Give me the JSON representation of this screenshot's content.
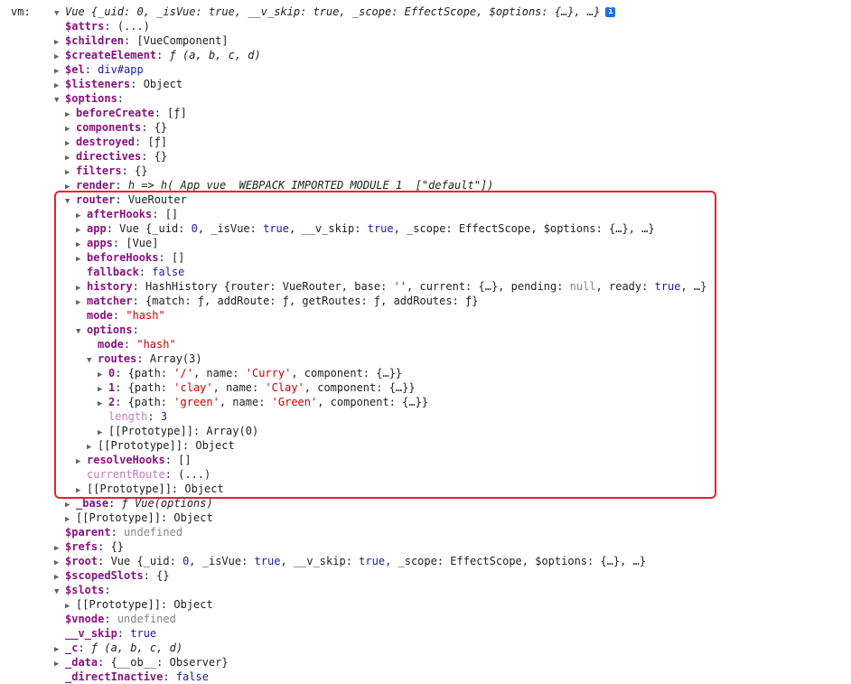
{
  "header": {
    "var_label": "vm:",
    "summary": "Vue {_uid: 0, _isVue: true, __v_skip: true, _scope: EffectScope, $options: {…}, …}",
    "info_icon": "info-icon"
  },
  "highlight_color": "#e8232b",
  "rows": [
    {
      "d": 0,
      "a": "",
      "k": "$attrs",
      "s": "own",
      "v": [
        [
          "(...)",
          "plain"
        ]
      ]
    },
    {
      "d": 0,
      "a": "c",
      "k": "$children",
      "s": "own",
      "v": [
        [
          "[VueComponent]",
          "plain"
        ]
      ]
    },
    {
      "d": 0,
      "a": "c",
      "k": "$createElement",
      "s": "own",
      "v": [
        [
          "ƒ (a, b, c, d)",
          "fn"
        ]
      ]
    },
    {
      "d": 0,
      "a": "c",
      "k": "$el",
      "s": "own",
      "v": [
        [
          "div#app",
          "kw"
        ]
      ]
    },
    {
      "d": 0,
      "a": "c",
      "k": "$listeners",
      "s": "own",
      "v": [
        [
          "Object",
          "plain"
        ]
      ]
    },
    {
      "d": 0,
      "a": "e",
      "k": "$options",
      "s": "own",
      "v": []
    },
    {
      "d": 1,
      "a": "c",
      "k": "beforeCreate",
      "s": "own",
      "v": [
        [
          "[ƒ]",
          "plain"
        ]
      ]
    },
    {
      "d": 1,
      "a": "c",
      "k": "components",
      "s": "own",
      "v": [
        [
          "{}",
          "plain"
        ]
      ]
    },
    {
      "d": 1,
      "a": "c",
      "k": "destroyed",
      "s": "own",
      "v": [
        [
          "[ƒ]",
          "plain"
        ]
      ]
    },
    {
      "d": 1,
      "a": "c",
      "k": "directives",
      "s": "own",
      "v": [
        [
          "{}",
          "plain"
        ]
      ]
    },
    {
      "d": 1,
      "a": "c",
      "k": "filters",
      "s": "own",
      "v": [
        [
          "{}",
          "plain"
        ]
      ]
    },
    {
      "d": 1,
      "a": "c",
      "k": "render",
      "s": "own",
      "v": [
        [
          "h => h(_App_vue__WEBPACK_IMPORTED_MODULE_1__[\"default\"])",
          "fn"
        ]
      ]
    },
    {
      "d": 1,
      "a": "e",
      "k": "router",
      "s": "own",
      "v": [
        [
          "VueRouter",
          "plain"
        ]
      ]
    },
    {
      "d": 2,
      "a": "c",
      "k": "afterHooks",
      "s": "own",
      "v": [
        [
          "[]",
          "plain"
        ]
      ]
    },
    {
      "d": 2,
      "a": "c",
      "k": "app",
      "s": "own",
      "v": [
        [
          "Vue {_uid: ",
          "plain"
        ],
        [
          "0",
          "num"
        ],
        [
          ", _isVue: ",
          "plain"
        ],
        [
          "true",
          "kw"
        ],
        [
          ", __v_skip: ",
          "plain"
        ],
        [
          "true",
          "kw"
        ],
        [
          ", _scope: EffectScope, $options: {…}, …}",
          "plain"
        ]
      ]
    },
    {
      "d": 2,
      "a": "c",
      "k": "apps",
      "s": "own",
      "v": [
        [
          "[Vue]",
          "plain"
        ]
      ]
    },
    {
      "d": 2,
      "a": "c",
      "k": "beforeHooks",
      "s": "own",
      "v": [
        [
          "[]",
          "plain"
        ]
      ]
    },
    {
      "d": 2,
      "a": "",
      "k": "fallback",
      "s": "own",
      "v": [
        [
          "false",
          "kw"
        ]
      ]
    },
    {
      "d": 2,
      "a": "c",
      "k": "history",
      "s": "own",
      "v": [
        [
          "HashHistory {router: VueRouter, base: ",
          "plain"
        ],
        [
          "''",
          "str"
        ],
        [
          ", current: {…}, pending: ",
          "plain"
        ],
        [
          "null",
          "undef"
        ],
        [
          ", ready: ",
          "plain"
        ],
        [
          "true",
          "kw"
        ],
        [
          ", …}",
          "plain"
        ]
      ]
    },
    {
      "d": 2,
      "a": "c",
      "k": "matcher",
      "s": "own",
      "v": [
        [
          "{match: ƒ, addRoute: ƒ, getRoutes: ƒ, addRoutes: ƒ}",
          "plain"
        ]
      ]
    },
    {
      "d": 2,
      "a": "",
      "k": "mode",
      "s": "own",
      "v": [
        [
          "\"hash\"",
          "str"
        ]
      ]
    },
    {
      "d": 2,
      "a": "e",
      "k": "options",
      "s": "own",
      "v": []
    },
    {
      "d": 3,
      "a": "",
      "k": "mode",
      "s": "own",
      "v": [
        [
          "\"hash\"",
          "str"
        ]
      ]
    },
    {
      "d": 3,
      "a": "e",
      "k": "routes",
      "s": "own",
      "v": [
        [
          "Array(3)",
          "plain"
        ]
      ]
    },
    {
      "d": 4,
      "a": "c",
      "k": "0",
      "s": "own",
      "v": [
        [
          "{path: ",
          "plain"
        ],
        [
          "'/'",
          "str"
        ],
        [
          ", name: ",
          "plain"
        ],
        [
          "'Curry'",
          "str"
        ],
        [
          ", component: {…}}",
          "plain"
        ]
      ]
    },
    {
      "d": 4,
      "a": "c",
      "k": "1",
      "s": "own",
      "v": [
        [
          "{path: ",
          "plain"
        ],
        [
          "'clay'",
          "str"
        ],
        [
          ", name: ",
          "plain"
        ],
        [
          "'Clay'",
          "str"
        ],
        [
          ", component: {…}}",
          "plain"
        ]
      ]
    },
    {
      "d": 4,
      "a": "c",
      "k": "2",
      "s": "own",
      "v": [
        [
          "{path: ",
          "plain"
        ],
        [
          "'green'",
          "str"
        ],
        [
          ", name: ",
          "plain"
        ],
        [
          "'Green'",
          "str"
        ],
        [
          ", component: {…}}",
          "plain"
        ]
      ]
    },
    {
      "d": 4,
      "a": "",
      "k": "length",
      "s": "dimnum",
      "v": [
        [
          "3",
          "num"
        ]
      ]
    },
    {
      "d": 4,
      "a": "c",
      "k": "[[Prototype]]",
      "s": "proto",
      "v": [
        [
          "Array(0)",
          "plain"
        ]
      ]
    },
    {
      "d": 3,
      "a": "c",
      "k": "[[Prototype]]",
      "s": "proto",
      "v": [
        [
          "Object",
          "plain"
        ]
      ]
    },
    {
      "d": 2,
      "a": "c",
      "k": "resolveHooks",
      "s": "own",
      "v": [
        [
          "[]",
          "plain"
        ]
      ]
    },
    {
      "d": 2,
      "a": "",
      "k": "currentRoute",
      "s": "dim",
      "v": [
        [
          "(...)",
          "plain"
        ]
      ]
    },
    {
      "d": 2,
      "a": "c",
      "k": "[[Prototype]]",
      "s": "proto",
      "v": [
        [
          "Object",
          "plain"
        ]
      ]
    },
    {
      "d": 1,
      "a": "c",
      "k": "_base",
      "s": "own",
      "v": [
        [
          "ƒ Vue(options)",
          "fn"
        ]
      ]
    },
    {
      "d": 1,
      "a": "c",
      "k": "[[Prototype]]",
      "s": "proto",
      "v": [
        [
          "Object",
          "plain"
        ]
      ]
    },
    {
      "d": 0,
      "a": "",
      "k": "$parent",
      "s": "own",
      "v": [
        [
          "undefined",
          "undef"
        ]
      ]
    },
    {
      "d": 0,
      "a": "c",
      "k": "$refs",
      "s": "own",
      "v": [
        [
          "{}",
          "plain"
        ]
      ]
    },
    {
      "d": 0,
      "a": "c",
      "k": "$root",
      "s": "own",
      "v": [
        [
          "Vue {_uid: ",
          "plain"
        ],
        [
          "0",
          "num"
        ],
        [
          ", _isVue: ",
          "plain"
        ],
        [
          "true",
          "kw"
        ],
        [
          ", __v_skip: ",
          "plain"
        ],
        [
          "true",
          "kw"
        ],
        [
          ", _scope: EffectScope, $options: {…}, …}",
          "plain"
        ]
      ]
    },
    {
      "d": 0,
      "a": "c",
      "k": "$scopedSlots",
      "s": "own",
      "v": [
        [
          "{}",
          "plain"
        ]
      ]
    },
    {
      "d": 0,
      "a": "e",
      "k": "$slots",
      "s": "own",
      "v": []
    },
    {
      "d": 1,
      "a": "c",
      "k": "[[Prototype]]",
      "s": "proto",
      "v": [
        [
          "Object",
          "plain"
        ]
      ]
    },
    {
      "d": 0,
      "a": "",
      "k": "$vnode",
      "s": "own",
      "v": [
        [
          "undefined",
          "undef"
        ]
      ]
    },
    {
      "d": 0,
      "a": "",
      "k": "__v_skip",
      "s": "own",
      "v": [
        [
          "true",
          "kw"
        ]
      ]
    },
    {
      "d": 0,
      "a": "c",
      "k": "_c",
      "s": "own",
      "v": [
        [
          "ƒ (a, b, c, d)",
          "fn"
        ]
      ]
    },
    {
      "d": 0,
      "a": "c",
      "k": "_data",
      "s": "own",
      "v": [
        [
          "{__ob__: Observer}",
          "plain"
        ]
      ]
    },
    {
      "d": 0,
      "a": "",
      "k": "_directInactive",
      "s": "own",
      "v": [
        [
          "false",
          "kw"
        ]
      ]
    }
  ]
}
